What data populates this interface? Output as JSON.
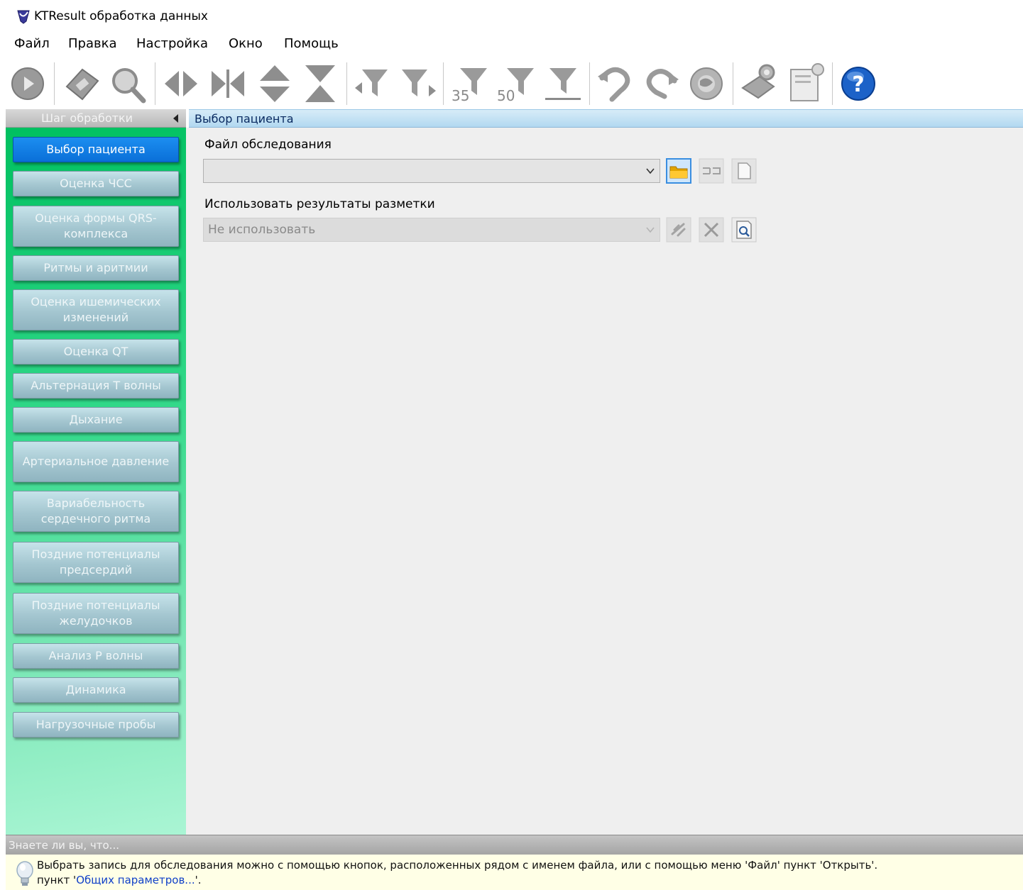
{
  "window": {
    "title": "KTResult обработка данных"
  },
  "menu": {
    "items": [
      "Файл",
      "Правка",
      "Настройка",
      "Окно",
      "Помощь"
    ]
  },
  "sidebar": {
    "header": "Шаг обработки",
    "steps": [
      {
        "label": "Выбор пациента",
        "active": true
      },
      {
        "label": "Оценка ЧСС"
      },
      {
        "label": "Оценка формы QRS-комплекса"
      },
      {
        "label": "Ритмы и аритмии"
      },
      {
        "label": "Оценка ишемических изменений"
      },
      {
        "label": "Оценка QT"
      },
      {
        "label": "Альтернация T волны"
      },
      {
        "label": "Дыхание"
      },
      {
        "label": "Артериальное давление"
      },
      {
        "label": "Вариабельность сердечного ритма"
      },
      {
        "label": "Поздние потенциалы предсердий"
      },
      {
        "label": "Поздние потенциалы желудочков"
      },
      {
        "label": "Анализ P волны"
      },
      {
        "label": "Динамика"
      },
      {
        "label": "Нагрузочные пробы"
      }
    ]
  },
  "main": {
    "title": "Выбор пациента",
    "file_label": "Файл обследования",
    "file_value": "",
    "markup_label": "Использовать результаты разметки",
    "markup_value": "Не использовать"
  },
  "toolbar": {
    "filter_35": "35",
    "filter_50": "50"
  },
  "tips": {
    "header": "Знаете ли вы, что...",
    "line1": "Выбрать запись для обследования можно с помощью кнопок, расположенных рядом с именем файла, или с помощью меню 'Файл' пункт 'Открыть'.",
    "line2_prefix": "пункт '",
    "line2_link": "Общих параметров...",
    "line2_suffix": "'."
  },
  "colors": {
    "active_step": "#0a6fd8",
    "sidebar_green": "#00c060",
    "header_blue": "#b2d8f0",
    "tip_background": "#ffffe6",
    "link": "#1040c8"
  },
  "icons": [
    "app-logo-icon",
    "play-icon",
    "save-icon",
    "zoom-icon",
    "expand-horizontal-icon",
    "collapse-horizontal-icon",
    "expand-vertical-icon",
    "collapse-vertical-icon",
    "filter-left-icon",
    "filter-right-icon",
    "filter-35-icon",
    "filter-50-icon",
    "filter-underline-icon",
    "undo-icon",
    "redo-icon",
    "globe-icon",
    "settings-icon",
    "notes-icon",
    "help-icon",
    "folder-open-icon",
    "split-icon",
    "new-document-icon",
    "link-icon",
    "delete-icon",
    "search-document-icon",
    "lightbulb-icon"
  ]
}
